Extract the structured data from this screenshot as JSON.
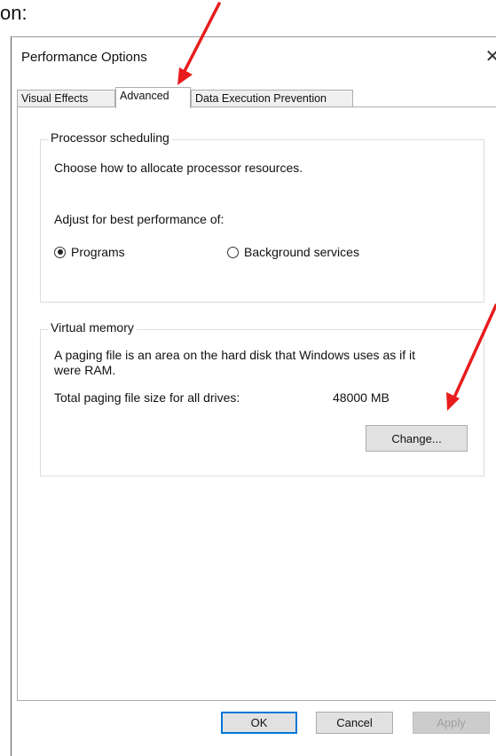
{
  "doc_text": "on:",
  "dialog": {
    "title": "Performance Options",
    "close_symbol": "✕",
    "tabs": [
      {
        "label": "Visual Effects",
        "active": false
      },
      {
        "label": "Advanced",
        "active": true
      },
      {
        "label": "Data Execution Prevention",
        "active": false
      }
    ],
    "processor_scheduling": {
      "legend": "Processor scheduling",
      "description": "Choose how to allocate processor resources.",
      "adjust_label": "Adjust for best performance of:",
      "options": [
        {
          "label": "Programs",
          "checked": true
        },
        {
          "label": "Background services",
          "checked": false
        }
      ]
    },
    "virtual_memory": {
      "legend": "Virtual memory",
      "description_line1": "A paging file is an area on the hard disk that Windows uses as if it",
      "description_line2": "were RAM.",
      "total_label": "Total paging file size for all drives:",
      "total_value": "48000 MB",
      "change_button": "Change..."
    },
    "buttons": {
      "ok": "OK",
      "cancel": "Cancel",
      "apply": "Apply"
    }
  },
  "annotations": {
    "arrow_color": "#e81c1c",
    "arrows": [
      "arrow-to-advanced-tab",
      "arrow-to-change-button"
    ]
  },
  "colors": {
    "accent": "#0078d7",
    "tab_inactive": "#f0f0f0",
    "button_face": "#e1e1e1"
  }
}
